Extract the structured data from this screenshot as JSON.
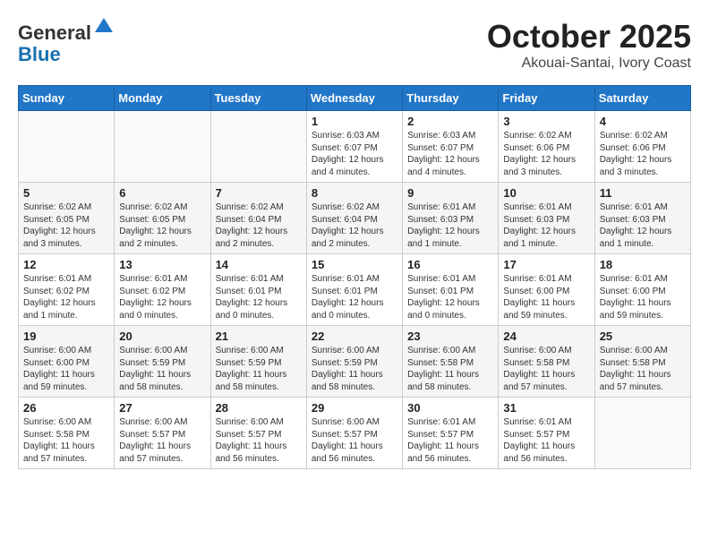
{
  "header": {
    "logo_line1": "General",
    "logo_line2": "Blue",
    "month": "October 2025",
    "location": "Akouai-Santai, Ivory Coast"
  },
  "weekdays": [
    "Sunday",
    "Monday",
    "Tuesday",
    "Wednesday",
    "Thursday",
    "Friday",
    "Saturday"
  ],
  "weeks": [
    [
      {
        "day": "",
        "info": ""
      },
      {
        "day": "",
        "info": ""
      },
      {
        "day": "",
        "info": ""
      },
      {
        "day": "1",
        "info": "Sunrise: 6:03 AM\nSunset: 6:07 PM\nDaylight: 12 hours\nand 4 minutes."
      },
      {
        "day": "2",
        "info": "Sunrise: 6:03 AM\nSunset: 6:07 PM\nDaylight: 12 hours\nand 4 minutes."
      },
      {
        "day": "3",
        "info": "Sunrise: 6:02 AM\nSunset: 6:06 PM\nDaylight: 12 hours\nand 3 minutes."
      },
      {
        "day": "4",
        "info": "Sunrise: 6:02 AM\nSunset: 6:06 PM\nDaylight: 12 hours\nand 3 minutes."
      }
    ],
    [
      {
        "day": "5",
        "info": "Sunrise: 6:02 AM\nSunset: 6:05 PM\nDaylight: 12 hours\nand 3 minutes."
      },
      {
        "day": "6",
        "info": "Sunrise: 6:02 AM\nSunset: 6:05 PM\nDaylight: 12 hours\nand 2 minutes."
      },
      {
        "day": "7",
        "info": "Sunrise: 6:02 AM\nSunset: 6:04 PM\nDaylight: 12 hours\nand 2 minutes."
      },
      {
        "day": "8",
        "info": "Sunrise: 6:02 AM\nSunset: 6:04 PM\nDaylight: 12 hours\nand 2 minutes."
      },
      {
        "day": "9",
        "info": "Sunrise: 6:01 AM\nSunset: 6:03 PM\nDaylight: 12 hours\nand 1 minute."
      },
      {
        "day": "10",
        "info": "Sunrise: 6:01 AM\nSunset: 6:03 PM\nDaylight: 12 hours\nand 1 minute."
      },
      {
        "day": "11",
        "info": "Sunrise: 6:01 AM\nSunset: 6:03 PM\nDaylight: 12 hours\nand 1 minute."
      }
    ],
    [
      {
        "day": "12",
        "info": "Sunrise: 6:01 AM\nSunset: 6:02 PM\nDaylight: 12 hours\nand 1 minute."
      },
      {
        "day": "13",
        "info": "Sunrise: 6:01 AM\nSunset: 6:02 PM\nDaylight: 12 hours\nand 0 minutes."
      },
      {
        "day": "14",
        "info": "Sunrise: 6:01 AM\nSunset: 6:01 PM\nDaylight: 12 hours\nand 0 minutes."
      },
      {
        "day": "15",
        "info": "Sunrise: 6:01 AM\nSunset: 6:01 PM\nDaylight: 12 hours\nand 0 minutes."
      },
      {
        "day": "16",
        "info": "Sunrise: 6:01 AM\nSunset: 6:01 PM\nDaylight: 12 hours\nand 0 minutes."
      },
      {
        "day": "17",
        "info": "Sunrise: 6:01 AM\nSunset: 6:00 PM\nDaylight: 11 hours\nand 59 minutes."
      },
      {
        "day": "18",
        "info": "Sunrise: 6:01 AM\nSunset: 6:00 PM\nDaylight: 11 hours\nand 59 minutes."
      }
    ],
    [
      {
        "day": "19",
        "info": "Sunrise: 6:00 AM\nSunset: 6:00 PM\nDaylight: 11 hours\nand 59 minutes."
      },
      {
        "day": "20",
        "info": "Sunrise: 6:00 AM\nSunset: 5:59 PM\nDaylight: 11 hours\nand 58 minutes."
      },
      {
        "day": "21",
        "info": "Sunrise: 6:00 AM\nSunset: 5:59 PM\nDaylight: 11 hours\nand 58 minutes."
      },
      {
        "day": "22",
        "info": "Sunrise: 6:00 AM\nSunset: 5:59 PM\nDaylight: 11 hours\nand 58 minutes."
      },
      {
        "day": "23",
        "info": "Sunrise: 6:00 AM\nSunset: 5:58 PM\nDaylight: 11 hours\nand 58 minutes."
      },
      {
        "day": "24",
        "info": "Sunrise: 6:00 AM\nSunset: 5:58 PM\nDaylight: 11 hours\nand 57 minutes."
      },
      {
        "day": "25",
        "info": "Sunrise: 6:00 AM\nSunset: 5:58 PM\nDaylight: 11 hours\nand 57 minutes."
      }
    ],
    [
      {
        "day": "26",
        "info": "Sunrise: 6:00 AM\nSunset: 5:58 PM\nDaylight: 11 hours\nand 57 minutes."
      },
      {
        "day": "27",
        "info": "Sunrise: 6:00 AM\nSunset: 5:57 PM\nDaylight: 11 hours\nand 57 minutes."
      },
      {
        "day": "28",
        "info": "Sunrise: 6:00 AM\nSunset: 5:57 PM\nDaylight: 11 hours\nand 56 minutes."
      },
      {
        "day": "29",
        "info": "Sunrise: 6:00 AM\nSunset: 5:57 PM\nDaylight: 11 hours\nand 56 minutes."
      },
      {
        "day": "30",
        "info": "Sunrise: 6:01 AM\nSunset: 5:57 PM\nDaylight: 11 hours\nand 56 minutes."
      },
      {
        "day": "31",
        "info": "Sunrise: 6:01 AM\nSunset: 5:57 PM\nDaylight: 11 hours\nand 56 minutes."
      },
      {
        "day": "",
        "info": ""
      }
    ]
  ]
}
